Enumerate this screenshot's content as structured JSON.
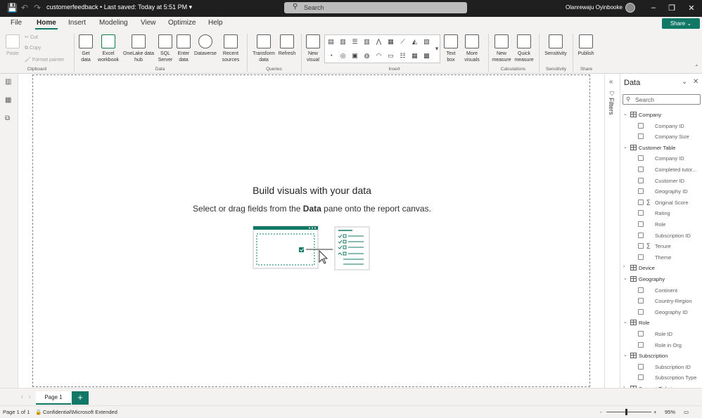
{
  "titlebar": {
    "document_name": "customerfeedback",
    "save_status": "Last saved: Today at 5:51 PM",
    "search_placeholder": "Search",
    "user_name": "Olanrewaju Oyinbooke"
  },
  "menu_tabs": [
    "File",
    "Home",
    "Insert",
    "Modeling",
    "View",
    "Optimize",
    "Help"
  ],
  "active_tab": "Home",
  "share_label": "Share",
  "ribbon": {
    "clipboard": {
      "paste": "Paste",
      "cut": "Cut",
      "copy": "Copy",
      "format_painter": "Format painter",
      "group": "Clipboard"
    },
    "data": {
      "get_data": "Get data",
      "excel": "Excel workbook",
      "onelake": "OneLake data hub",
      "sql": "SQL Server",
      "enter": "Enter data",
      "dataverse": "Dataverse",
      "recent": "Recent sources",
      "group": "Data"
    },
    "queries": {
      "transform": "Transform data",
      "refresh": "Refresh",
      "group": "Queries"
    },
    "insert": {
      "new_visual": "New visual",
      "text_box": "Text box",
      "more_visuals": "More visuals",
      "group": "Insert"
    },
    "calculations": {
      "new_measure": "New measure",
      "quick_measure": "Quick measure",
      "group": "Calculations"
    },
    "sensitivity": {
      "label": "Sensitivity",
      "group": "Sensitivity"
    },
    "share": {
      "publish": "Publish",
      "group": "Share"
    }
  },
  "canvas": {
    "empty_title": "Build visuals with your data",
    "empty_sub_prefix": "Select or drag fields from the",
    "empty_sub_bold": "Data",
    "empty_sub_suffix": "pane onto the report canvas."
  },
  "filters_label": "Filters",
  "data_pane": {
    "title": "Data",
    "search_placeholder": "Search",
    "tables": [
      {
        "name": "Company",
        "expanded": true,
        "fields": [
          {
            "name": "Company ID",
            "sum": false
          },
          {
            "name": "Company Size",
            "sum": false
          }
        ]
      },
      {
        "name": "Customer Table",
        "expanded": true,
        "fields": [
          {
            "name": "Company ID",
            "sum": false
          },
          {
            "name": "Completed tutor...",
            "sum": false
          },
          {
            "name": "Customer ID",
            "sum": false
          },
          {
            "name": "Geography ID",
            "sum": false
          },
          {
            "name": "Original Score",
            "sum": true
          },
          {
            "name": "Rating",
            "sum": false
          },
          {
            "name": "Role",
            "sum": false
          },
          {
            "name": "Subscription ID",
            "sum": false
          },
          {
            "name": "Tenure",
            "sum": true
          },
          {
            "name": "Theme",
            "sum": false
          }
        ]
      },
      {
        "name": "Device",
        "expanded": false,
        "fields": []
      },
      {
        "name": "Geography",
        "expanded": true,
        "fields": [
          {
            "name": "Continent",
            "sum": false
          },
          {
            "name": "Country-Region",
            "sum": false
          },
          {
            "name": "Geography ID",
            "sum": false
          }
        ]
      },
      {
        "name": "Role",
        "expanded": true,
        "fields": [
          {
            "name": "Role ID",
            "sum": false
          },
          {
            "name": "Role in Org",
            "sum": false
          }
        ]
      },
      {
        "name": "Subscription",
        "expanded": true,
        "fields": [
          {
            "name": "Subscription ID",
            "sum": false
          },
          {
            "name": "Subscription Type",
            "sum": false
          }
        ]
      },
      {
        "name": "Support Tickets",
        "expanded": false,
        "fields": []
      }
    ]
  },
  "pages": {
    "tab": "Page 1",
    "add": "+"
  },
  "status": {
    "page_count": "Page 1 of 1",
    "sensitivity": "Confidential\\Microsoft Extended",
    "zoom": "95%"
  },
  "colors": {
    "accent": "#117865",
    "titlebar": "#1f1f1f"
  }
}
